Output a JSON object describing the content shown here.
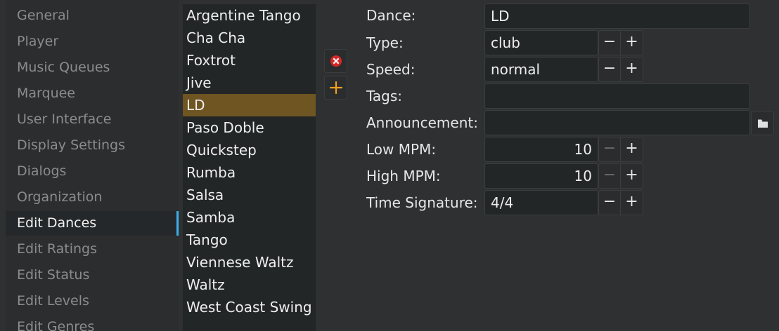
{
  "nav": {
    "items": [
      {
        "label": "General"
      },
      {
        "label": "Player"
      },
      {
        "label": "Music Queues"
      },
      {
        "label": "Marquee"
      },
      {
        "label": "User Interface"
      },
      {
        "label": "Display Settings"
      },
      {
        "label": "Dialogs"
      },
      {
        "label": "Organization"
      },
      {
        "label": "Edit Dances",
        "active": true
      },
      {
        "label": "Edit Ratings"
      },
      {
        "label": "Edit Status"
      },
      {
        "label": "Edit Levels"
      },
      {
        "label": "Edit Genres"
      }
    ]
  },
  "dances": {
    "items": [
      "Argentine Tango",
      "Cha Cha",
      "Foxtrot",
      "Jive",
      "LD",
      "Paso Doble",
      "Quickstep",
      "Rumba",
      "Salsa",
      "Samba",
      "Tango",
      "Viennese Waltz",
      "Waltz",
      "West Coast Swing"
    ],
    "selected": "LD"
  },
  "actions": {
    "delete_icon": "delete-circle-icon",
    "add_icon": "plus-icon"
  },
  "form": {
    "dance": {
      "label": "Dance:",
      "value": "LD"
    },
    "type": {
      "label": "Type:",
      "value": "club"
    },
    "speed": {
      "label": "Speed:",
      "value": "normal"
    },
    "tags": {
      "label": "Tags:",
      "value": ""
    },
    "announcement": {
      "label": "Announcement:",
      "value": ""
    },
    "low_mpm": {
      "label": "Low MPM:",
      "value": "10"
    },
    "high_mpm": {
      "label": "High MPM:",
      "value": "10"
    },
    "time_signature": {
      "label": "Time Signature:",
      "value": "4/4"
    },
    "minus": "−",
    "plus": "+"
  },
  "colors": {
    "selection": "#6f5522",
    "active_indicator": "#3daee9",
    "add_icon": "#f0a020",
    "delete_icon": "#d62828"
  }
}
